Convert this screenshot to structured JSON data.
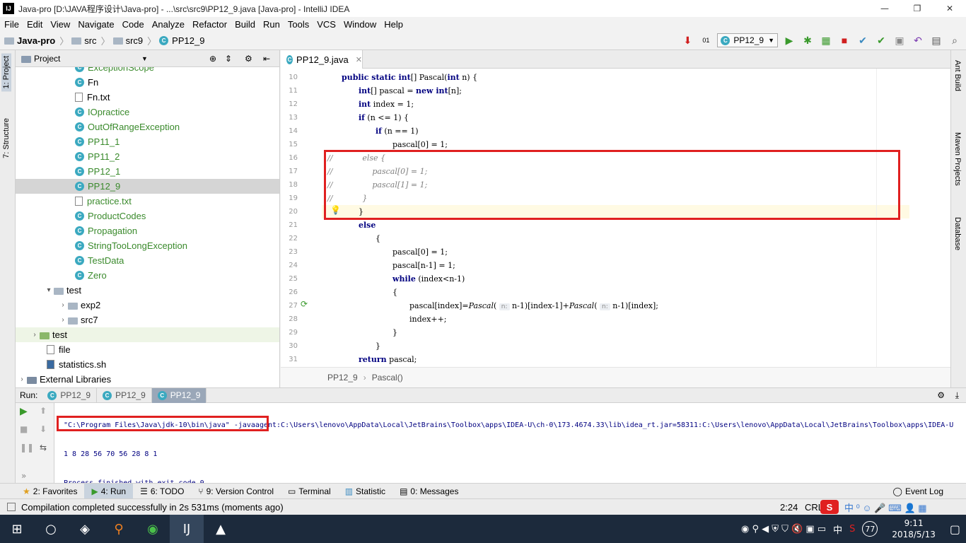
{
  "window": {
    "title": "Java-pro [D:\\JAVA程序设计\\Java-pro] - ...\\src\\src9\\PP12_9.java [Java-pro] - IntelliJ IDEA",
    "minimize": "—",
    "maximize": "❐",
    "close": "✕"
  },
  "menu": [
    "File",
    "Edit",
    "View",
    "Navigate",
    "Code",
    "Analyze",
    "Refactor",
    "Build",
    "Run",
    "Tools",
    "VCS",
    "Window",
    "Help"
  ],
  "breadcrumb": [
    "Java-pro",
    "src",
    "src9",
    "PP12_9"
  ],
  "toolbar": {
    "run_config": "PP12_9"
  },
  "left_tabs": {
    "project": "1: Project",
    "structure": "7: Structure"
  },
  "right_tabs": {
    "ant": "Ant Build",
    "maven": "Maven Projects",
    "database": "Database"
  },
  "project": {
    "header": "Project",
    "items": [
      {
        "label": "ExceptionScope",
        "type": "class",
        "color": "green"
      },
      {
        "label": "Fn",
        "type": "class",
        "color": "black"
      },
      {
        "label": "Fn.txt",
        "type": "file",
        "color": "black"
      },
      {
        "label": "IOpractice",
        "type": "class",
        "color": "green"
      },
      {
        "label": "OutOfRangeException",
        "type": "class",
        "color": "green"
      },
      {
        "label": "PP11_1",
        "type": "class",
        "color": "green"
      },
      {
        "label": "PP11_2",
        "type": "class",
        "color": "green"
      },
      {
        "label": "PP12_1",
        "type": "class",
        "color": "green"
      },
      {
        "label": "PP12_9",
        "type": "class",
        "color": "green",
        "selected": true
      },
      {
        "label": "practice.txt",
        "type": "file",
        "color": "green"
      },
      {
        "label": "ProductCodes",
        "type": "class",
        "color": "green"
      },
      {
        "label": "Propagation",
        "type": "class",
        "color": "green"
      },
      {
        "label": "StringTooLongException",
        "type": "class",
        "color": "green"
      },
      {
        "label": "TestData",
        "type": "class",
        "color": "green"
      },
      {
        "label": "Zero",
        "type": "class",
        "color": "green"
      }
    ],
    "test_folder": "test",
    "test_children": [
      "exp2",
      "src7"
    ],
    "test2": "test",
    "file": "file",
    "statistics": "statistics.sh",
    "external": "External Libraries"
  },
  "editor": {
    "tab": "PP12_9.java",
    "lines": [
      {
        "n": "10",
        "html": "<span class='kw'>public static int</span>[] Pascal(<span class='kw'>int</span> n) {",
        "indent": 0
      },
      {
        "n": "11",
        "html": "<span class='kw'>int</span>[] pascal = <span class='kw'>new int</span>[n];",
        "indent": 1
      },
      {
        "n": "12",
        "html": "<span class='kw'>int</span> index = 1;",
        "indent": 1
      },
      {
        "n": "13",
        "html": "<span class='kw'>if</span> (n &lt;= 1) {",
        "indent": 1
      },
      {
        "n": "14",
        "html": "<span class='kw'>if</span> (n == 1)",
        "indent": 2
      },
      {
        "n": "15",
        "html": "pascal[0] = 1;",
        "indent": 3
      },
      {
        "n": "16",
        "html": "<span class='cm'>//            else {</span>",
        "indent": -1
      },
      {
        "n": "17",
        "html": "<span class='cm'>//                pascal[0] = 1;</span>",
        "indent": -1
      },
      {
        "n": "18",
        "html": "<span class='cm'>//                pascal[1] = 1;</span>",
        "indent": -1
      },
      {
        "n": "19",
        "html": "<span class='cm'>//            }</span>",
        "indent": -1
      },
      {
        "n": "20",
        "html": "}",
        "indent": 1
      },
      {
        "n": "21",
        "html": "<span class='kw'>else</span>",
        "indent": 1
      },
      {
        "n": "22",
        "html": "{",
        "indent": 2
      },
      {
        "n": "23",
        "html": "pascal[0] = 1;",
        "indent": 3
      },
      {
        "n": "24",
        "html": "pascal[n-1] = 1;",
        "indent": 3
      },
      {
        "n": "25",
        "html": "<span class='kw'>while</span> (index&lt;n-1)",
        "indent": 3
      },
      {
        "n": "26",
        "html": "{",
        "indent": 3
      },
      {
        "n": "27",
        "html": "pascal[index]=<span class='it'>Pascal</span>( <span class='hint'>n:</span> n-1)[index-1]+<span class='it'>Pascal</span>( <span class='hint'>n:</span> n-1)[index];",
        "indent": 4
      },
      {
        "n": "28",
        "html": "index++;",
        "indent": 4
      },
      {
        "n": "29",
        "html": "}",
        "indent": 3
      },
      {
        "n": "30",
        "html": "}",
        "indent": 2
      },
      {
        "n": "31",
        "html": "<span class='kw'>return</span> pascal;",
        "indent": 1
      }
    ],
    "breadcrumb": [
      "PP12_9",
      "Pascal()"
    ]
  },
  "run": {
    "label": "Run:",
    "tabs": [
      "PP12_9",
      "PP12_9",
      "PP12_9"
    ],
    "console": [
      "\"C:\\Program Files\\Java\\jdk-10\\bin\\java\" -javaagent:C:\\Users\\lenovo\\AppData\\Local\\JetBrains\\Toolbox\\apps\\IDEA-U\\ch-0\\173.4674.33\\lib\\idea_rt.jar=58311:C:\\Users\\lenovo\\AppData\\Local\\JetBrains\\Toolbox\\apps\\IDEA-U",
      "1 8 28 56 70 56 28 8 1",
      "Process finished with exit code 0"
    ]
  },
  "bottom_tools": [
    "2: Favorites",
    "4: Run",
    "6: TODO",
    "9: Version Control",
    "Terminal",
    "Statistic",
    "0: Messages"
  ],
  "event_log": "Event Log",
  "status": {
    "message": "Compilation completed successfully in 2s 531ms (moments ago)",
    "position": "2:24",
    "crlf": "CRLF"
  },
  "taskbar": {
    "time": "9:11",
    "date": "2018/5/13",
    "ime": "中",
    "badge": "77"
  },
  "colors": {
    "accent_red": "#e02020",
    "green_file": "#3a8a2c",
    "selection": "#d5d5d5"
  }
}
